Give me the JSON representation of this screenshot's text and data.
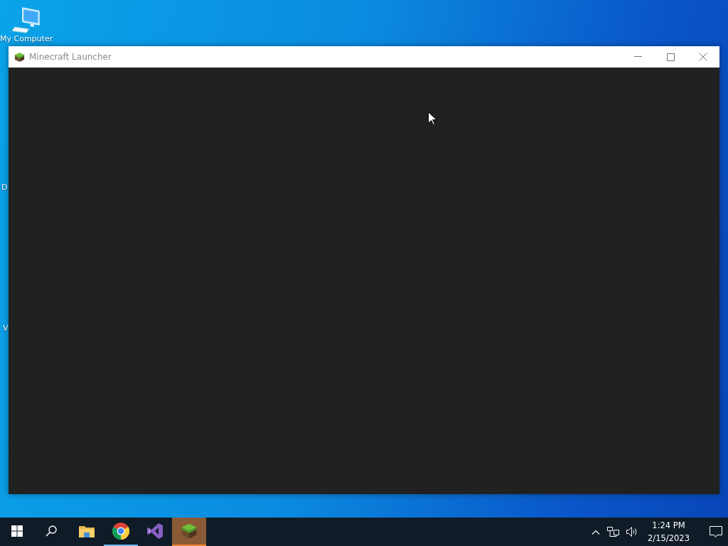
{
  "desktop": {
    "icons": [
      {
        "kind": "computer",
        "label": "My Computer"
      },
      {
        "kind": "hidden",
        "label": "D"
      },
      {
        "kind": "hidden",
        "label": "V"
      }
    ]
  },
  "window": {
    "title": "Minecraft Launcher"
  },
  "taskbar": {
    "apps": [
      {
        "kind": "start",
        "running": false,
        "selected": false
      },
      {
        "kind": "search",
        "running": false,
        "selected": false
      },
      {
        "kind": "folder",
        "running": false,
        "selected": false
      },
      {
        "kind": "chrome",
        "running": true,
        "selected": false
      },
      {
        "kind": "studio",
        "running": false,
        "selected": false
      },
      {
        "kind": "grass",
        "running": true,
        "selected": true
      }
    ],
    "tray": {
      "time": "1:24 PM",
      "date": "2/15/2023"
    }
  }
}
